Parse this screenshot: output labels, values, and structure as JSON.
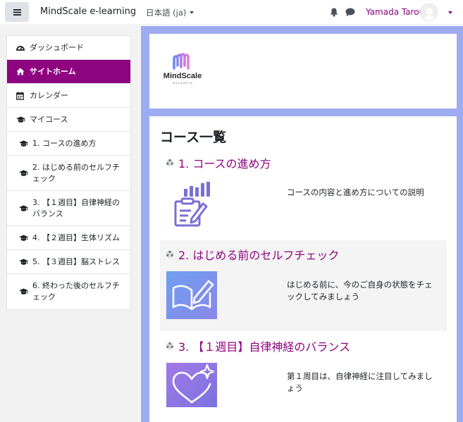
{
  "navbar": {
    "brand": "MindScale e-learning",
    "language": "日本語 (ja)",
    "user_name": "Yamada Tarou",
    "icons": [
      "menu-icon",
      "bell-icon",
      "chat-icon",
      "avatar",
      "chevron-down-icon"
    ],
    "accent_color": "#8e037f"
  },
  "sidebar": {
    "items": [
      {
        "label": "ダッシュボード",
        "icon": "dashboard-icon"
      },
      {
        "label": "サイトホーム",
        "icon": "home-icon",
        "active": true
      },
      {
        "label": "カレンダー",
        "icon": "calendar-icon"
      },
      {
        "label": "マイコース",
        "icon": "graduation-cap-icon"
      },
      {
        "label": "1. コースの進め方",
        "icon": "graduation-cap-icon"
      },
      {
        "label": "2. はじめる前のセルフチェック",
        "icon": "graduation-cap-icon"
      },
      {
        "label": "3. 【１週目】自律神経のバランス",
        "icon": "graduation-cap-icon"
      },
      {
        "label": "4. 【２週目】生体リズム",
        "icon": "graduation-cap-icon"
      },
      {
        "label": "5. 【３週目】脳ストレス",
        "icon": "graduation-cap-icon"
      },
      {
        "label": "6. 終わった後のセルフチェック",
        "icon": "graduation-cap-icon"
      }
    ]
  },
  "logo": {
    "name": "MindScale",
    "kana": "マインドスケール"
  },
  "main": {
    "heading": "コース一覧",
    "courses": [
      {
        "title": "1. コースの進め方",
        "description": "コースの内容と進め方についての説明",
        "icon": "clipboard-chart-icon"
      },
      {
        "title": "2. はじめる前のセルフチェック",
        "description": "はじめる前に、今のご自身の状態をチェックしてみましょう",
        "icon": "book-pen-icon"
      },
      {
        "title": "3. 【１週目】自律神経のバランス",
        "description": "第１周目は、自律神経に注目してみましょう",
        "icon": "heart-sparkle-icon"
      }
    ]
  }
}
